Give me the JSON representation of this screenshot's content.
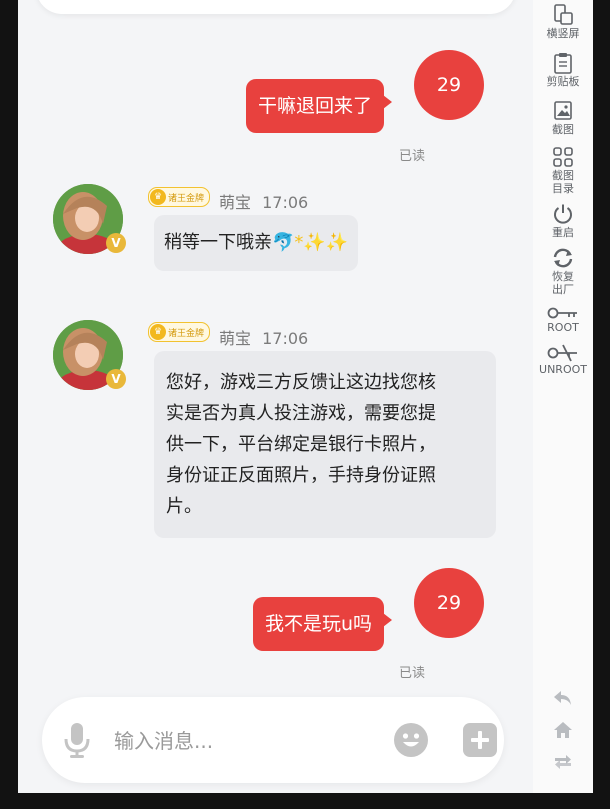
{
  "sidebar": {
    "items": [
      {
        "label": "横竖屏",
        "icon": "rotate-screen-icon"
      },
      {
        "label": "剪贴板",
        "icon": "clipboard-icon"
      },
      {
        "label": "截图",
        "icon": "screenshot-icon"
      },
      {
        "label": "截图\n目录",
        "icon": "screenshot-folder-icon"
      },
      {
        "label": "重启",
        "icon": "power-icon"
      },
      {
        "label": "恢复\n出厂",
        "icon": "factory-reset-icon"
      },
      {
        "label": "ROOT",
        "icon": "key-icon"
      },
      {
        "label": "UNROOT",
        "icon": "unroot-key-icon"
      }
    ],
    "nav": [
      {
        "icon": "back-icon"
      },
      {
        "icon": "home-icon"
      },
      {
        "icon": "switch-icon"
      }
    ]
  },
  "messages": {
    "out1": {
      "text": "干嘛退回来了",
      "badge": "29",
      "status": "已读"
    },
    "in1": {
      "vip": "诸王金牌",
      "sender": "萌宝",
      "time": "17:06",
      "text": "稍等一下哦亲",
      "emoji": "🐬*✨✨",
      "avatar_badge": "V"
    },
    "in2": {
      "vip": "诸王金牌",
      "sender": "萌宝",
      "time": "17:06",
      "text": "您好，游戏三方反馈让这边找您核\n实是否为真人投注游戏，需要您提\n供一下，平台绑定是银行卡照片，\n身份证正反面照片，手持身份证照\n片。",
      "avatar_badge": "V"
    },
    "out2": {
      "text": "我不是玩u吗",
      "badge": "29",
      "status": "已读"
    }
  },
  "composer": {
    "placeholder": "输入消息..."
  },
  "colors": {
    "accent": "#e8413e",
    "incoming_bubble": "#e9eaed",
    "background": "#f4f5f7"
  }
}
